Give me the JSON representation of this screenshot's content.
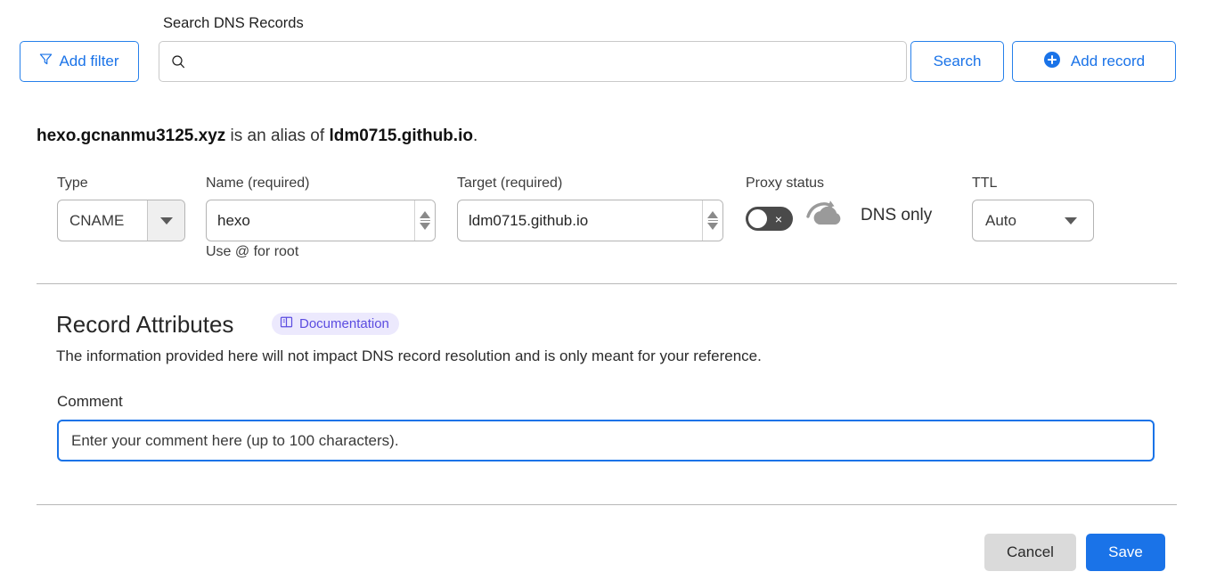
{
  "toolbar": {
    "add_filter_label": "Add filter",
    "search_label": "Search DNS Records",
    "search_value": "",
    "search_placeholder": "",
    "search_button_label": "Search",
    "add_record_label": "Add record"
  },
  "record_summary": {
    "name": "hexo.gcnanmu3125.xyz",
    "connector": " is an alias of ",
    "target": "ldm0715.github.io",
    "period": "."
  },
  "form": {
    "type_label": "Type",
    "type_value": "CNAME",
    "name_label": "Name (required)",
    "name_value": "hexo",
    "name_hint": "Use @ for root",
    "target_label": "Target (required)",
    "target_value": "ldm0715.github.io",
    "proxy_label": "Proxy status",
    "proxy_state_text": "DNS only",
    "proxy_toggle_glyph": "×",
    "ttl_label": "TTL",
    "ttl_value": "Auto"
  },
  "attributes": {
    "title": "Record Attributes",
    "doc_badge_label": "Documentation",
    "description": "The information provided here will not impact DNS record resolution and is only meant for your reference.",
    "comment_label": "Comment",
    "comment_value": "",
    "comment_placeholder": "Enter your comment here (up to 100 characters)."
  },
  "footer": {
    "cancel_label": "Cancel",
    "save_label": "Save"
  },
  "colors": {
    "accent_blue": "#1a73e8",
    "border_blue": "#2680eb",
    "badge_purple_text": "#5b4ce0",
    "badge_purple_bg": "#ece9fd",
    "toggle_off_gray": "#4a4a4a",
    "cancel_gray": "#dadada"
  }
}
